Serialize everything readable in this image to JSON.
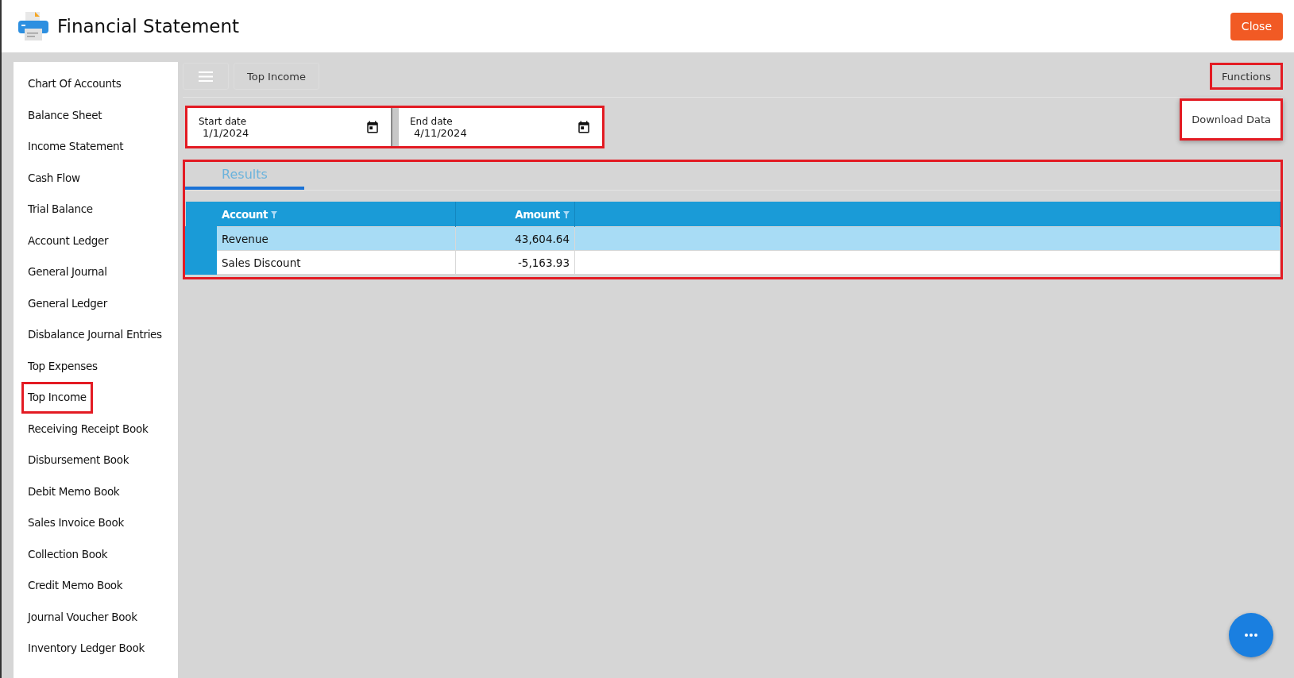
{
  "window": {
    "title": "Financial Statement",
    "close_button": "Close"
  },
  "sidebar": {
    "items": [
      {
        "label": "Chart Of Accounts",
        "highlighted": false
      },
      {
        "label": "Balance Sheet",
        "highlighted": false
      },
      {
        "label": "Income Statement",
        "highlighted": false
      },
      {
        "label": "Cash Flow",
        "highlighted": false
      },
      {
        "label": "Trial Balance",
        "highlighted": false
      },
      {
        "label": "Account Ledger",
        "highlighted": false
      },
      {
        "label": "General Journal",
        "highlighted": false
      },
      {
        "label": "General Ledger",
        "highlighted": false
      },
      {
        "label": "Disbalance Journal Entries",
        "highlighted": false
      },
      {
        "label": "Top Expenses",
        "highlighted": false
      },
      {
        "label": "Top Income",
        "highlighted": true
      },
      {
        "label": "Receiving Receipt Book",
        "highlighted": false
      },
      {
        "label": "Disbursement Book",
        "highlighted": false
      },
      {
        "label": "Debit Memo Book",
        "highlighted": false
      },
      {
        "label": "Sales Invoice Book",
        "highlighted": false
      },
      {
        "label": "Collection Book",
        "highlighted": false
      },
      {
        "label": "Credit Memo Book",
        "highlighted": false
      },
      {
        "label": "Journal Voucher Book",
        "highlighted": false
      },
      {
        "label": "Inventory Ledger Book",
        "highlighted": false
      }
    ]
  },
  "toolbar": {
    "breadcrumb": "Top Income",
    "functions": {
      "label": "Functions",
      "highlighted": true
    },
    "functions_menu": {
      "items": [
        "Download Data"
      ],
      "highlighted": true
    }
  },
  "date_range": {
    "highlighted": true,
    "fields": [
      {
        "label": "Start date",
        "value": "1/1/2024"
      },
      {
        "label": "End date",
        "value": "4/11/2024"
      }
    ]
  },
  "results": {
    "highlighted": true,
    "tabs": [
      {
        "label": "Results",
        "selected": true
      }
    ],
    "table": {
      "columns": [
        {
          "label": "Account"
        },
        {
          "label": "Amount"
        }
      ],
      "rows": [
        {
          "cells": [
            "Revenue",
            "43,604.64"
          ],
          "selected": true
        },
        {
          "cells": [
            "Sales Discount",
            "-5,163.93"
          ],
          "selected": false
        }
      ]
    }
  }
}
